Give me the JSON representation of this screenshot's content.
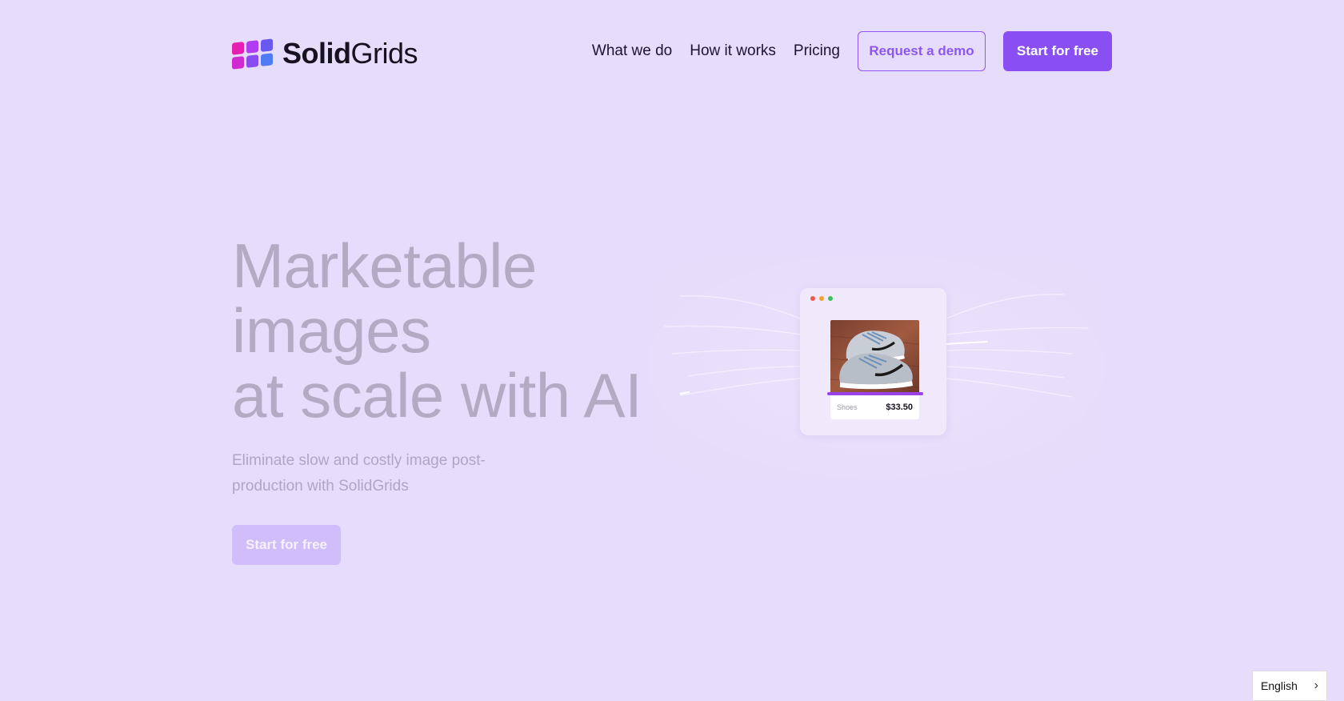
{
  "brand": {
    "name_bold": "Solid",
    "name_light": "Grids",
    "logo_colors": [
      "#e61fb2",
      "#b03bf0",
      "#6a59ee",
      "#d12ad0",
      "#8a4bf0",
      "#4f7cf4"
    ]
  },
  "nav": {
    "links": [
      {
        "label": "What we do"
      },
      {
        "label": "How it works"
      },
      {
        "label": "Pricing"
      }
    ],
    "demo_label": "Request a demo",
    "start_label": "Start for free"
  },
  "hero": {
    "title_line1": "Marketable",
    "title_line2": "images",
    "title_line3": "at scale with AI",
    "subtitle": "Eliminate slow and costly image post-production with SolidGrids",
    "cta_label": "Start for free"
  },
  "product_card": {
    "category": "Shoes",
    "price": "$33.50",
    "window_dots": [
      "#f05a4a",
      "#f4a12c",
      "#39c15a"
    ]
  },
  "language_selector": {
    "value": "English"
  },
  "colors": {
    "background": "#e6dcfb",
    "accent": "#8a4ff2",
    "accent_muted": "#d2bdfb"
  }
}
